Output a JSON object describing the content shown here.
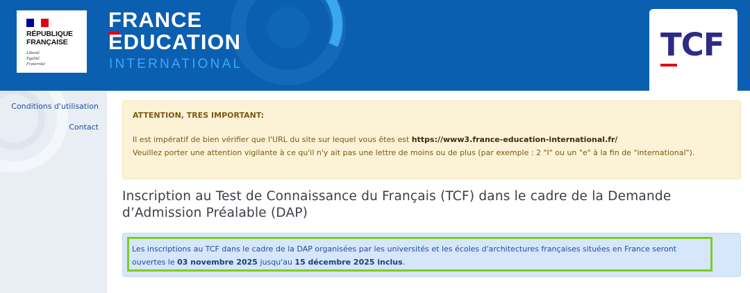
{
  "header": {
    "republique": {
      "title": "RÉPUBLIQUE\nFRANÇAISE",
      "motto": "Liberté\nÉgalité\nFraternité",
      "flag_colors": [
        "#000091",
        "#ffffff",
        "#e1000f"
      ]
    },
    "fei": {
      "line1": "FRANCE",
      "line2": "EDUCATION",
      "line3": "INTERNATIONAL"
    },
    "tcf_logo": "TCF",
    "colors": {
      "header_bg": "#0b5fb0",
      "accent_red": "#e1000f",
      "tcf_blue": "#2e2b86"
    }
  },
  "sidebar": {
    "links": [
      {
        "label": "Conditions d'utilisation"
      },
      {
        "label": "Contact"
      }
    ]
  },
  "warning": {
    "title": "ATTENTION, TRES IMPORTANT:",
    "line1_prefix": "Il est impératif de bien vérifier que l'URL du site sur lequel vous êtes est ",
    "url": "https://www3.france-education-international.fr/",
    "line2": "Veuillez porter une attention vigilante à ce qu'il n'y ait pas une lettre de moins ou de plus (par exemple : 2 \"l\" ou un \"e\" à la fin de \"international\")."
  },
  "page_title": "Inscription au Test de Connaissance du Français (TCF) dans le cadre de la Demande d’Admission Préalable (DAP)",
  "info": {
    "text_a": "Les inscriptions au TCF dans le cadre de la DAP organisées par les universités et les écoles d'architectures françaises situées en France seront ouvertes le ",
    "date_start": "03 novembre 2025",
    "text_b": " jusqu'au ",
    "date_end": "15 décembre 2025 inclus",
    "text_c": "."
  }
}
